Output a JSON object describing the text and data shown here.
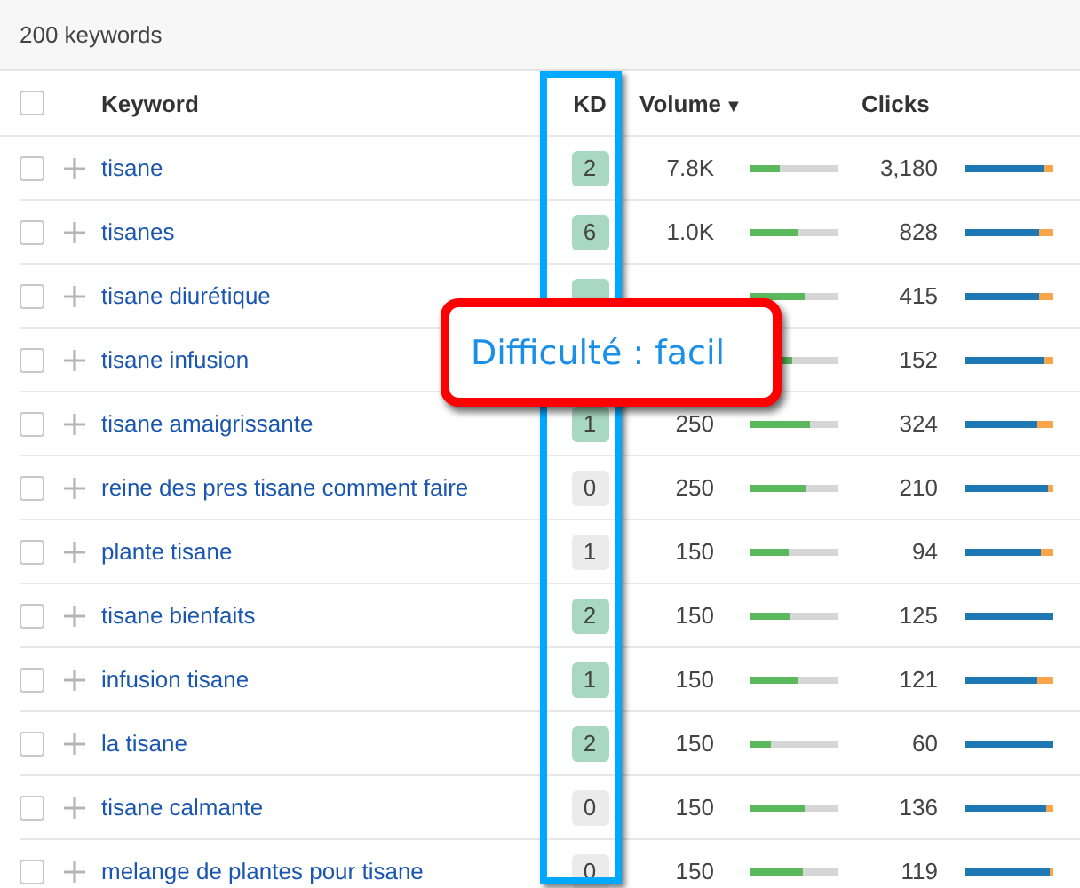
{
  "summary": "200 keywords",
  "columns": {
    "select_all_checked": false,
    "keyword": "Keyword",
    "kd": "KD",
    "volume": "Volume",
    "sort_indicator": "▼",
    "clicks": "Clicks"
  },
  "rows": [
    {
      "checked": false,
      "keyword": "tisane",
      "kd": {
        "value": "2",
        "color": "#a8d8c0"
      },
      "volume": "7.8K",
      "volume_bar": {
        "level": 0.33
      },
      "clicks": "3,180",
      "clicks_bar": {
        "level": 0.9
      }
    },
    {
      "checked": false,
      "keyword": "tisanes",
      "kd": {
        "value": "6",
        "color": "#a8d8c0"
      },
      "volume": "1.0K",
      "volume_bar": {
        "level": 0.53
      },
      "clicks": "828",
      "clicks_bar": {
        "level": 0.84
      }
    },
    {
      "checked": false,
      "keyword": "tisane diurétique",
      "kd": {
        "color": "#a8d8c0"
      },
      "volume_bar": {
        "level": 0.62
      },
      "clicks": "415",
      "clicks_bar": {
        "level": 0.84
      }
    },
    {
      "checked": false,
      "keyword": "tisane infusion",
      "volume_bar": {
        "level": 0.48
      },
      "clicks": "152",
      "clicks_bar": {
        "level": 0.9
      }
    },
    {
      "checked": false,
      "keyword": "tisane amaigrissante",
      "kd": {
        "value": "1",
        "color": "#a8d8c0"
      },
      "volume": "250",
      "volume_bar": {
        "level": 0.68
      },
      "clicks": "324",
      "clicks_bar": {
        "level": 0.82
      }
    },
    {
      "checked": false,
      "keyword": "reine des pres tisane comment faire",
      "kd": {
        "value": "0",
        "color": "#ebebeb"
      },
      "volume": "250",
      "volume_bar": {
        "level": 0.64
      },
      "clicks": "210",
      "clicks_bar": {
        "level": 0.94
      }
    },
    {
      "checked": false,
      "keyword": "plante tisane",
      "kd": {
        "value": "1",
        "color": "#ebebeb"
      },
      "volume": "150",
      "volume_bar": {
        "level": 0.44
      },
      "clicks": "94",
      "clicks_bar": {
        "level": 0.86
      }
    },
    {
      "checked": false,
      "keyword": "tisane bienfaits",
      "kd": {
        "value": "2",
        "color": "#a8d8c0"
      },
      "volume": "150",
      "volume_bar": {
        "level": 0.46
      },
      "clicks": "125",
      "clicks_bar": {
        "level": 1.0
      }
    },
    {
      "checked": false,
      "keyword": "infusion tisane",
      "kd": {
        "value": "1",
        "color": "#a8d8c0"
      },
      "volume": "150",
      "volume_bar": {
        "level": 0.54
      },
      "clicks": "121",
      "clicks_bar": {
        "level": 0.82
      }
    },
    {
      "checked": false,
      "keyword": "la tisane",
      "kd": {
        "value": "2",
        "color": "#a8d8c0"
      },
      "volume": "150",
      "volume_bar": {
        "level": 0.24
      },
      "clicks": "60",
      "clicks_bar": {
        "level": 1.0
      }
    },
    {
      "checked": false,
      "keyword": "tisane calmante",
      "kd": {
        "value": "0",
        "color": "#ebebeb"
      },
      "volume": "150",
      "volume_bar": {
        "level": 0.62
      },
      "clicks": "136",
      "clicks_bar": {
        "level": 0.92
      }
    },
    {
      "checked": false,
      "keyword": "melange de plantes pour tisane",
      "kd": {
        "value": "0",
        "color": "#ebebeb"
      },
      "volume": "150",
      "volume_bar": {
        "level": 0.6
      },
      "clicks": "119",
      "clicks_bar": {
        "level": 0.96
      }
    }
  ],
  "tooltip": {
    "text": "Difficulté : facil"
  }
}
